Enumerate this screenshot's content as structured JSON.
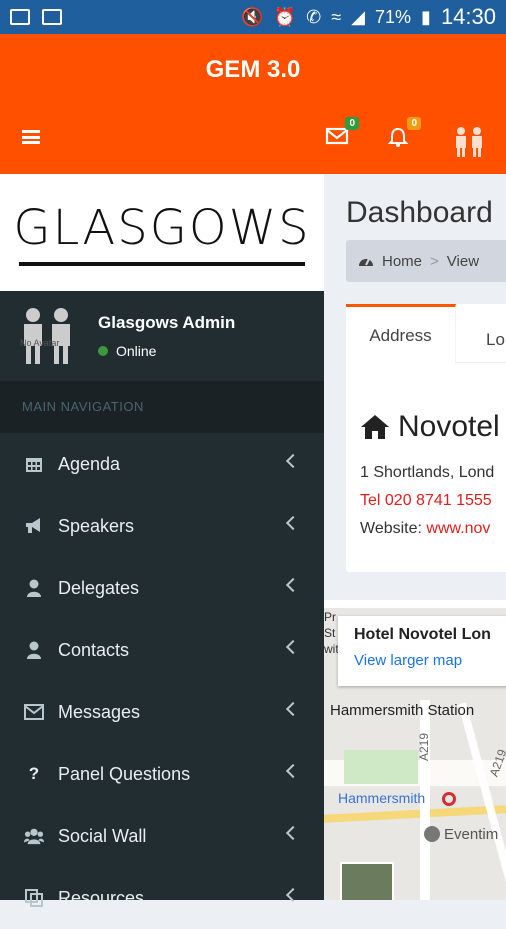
{
  "status_bar": {
    "battery": "71%",
    "time": "14:30"
  },
  "app": {
    "title": "GEM 3.0"
  },
  "header": {
    "mail_badge": "0",
    "bell_badge": "0",
    "colors": {
      "appbar": "#ff5000",
      "mail_badge": "#2e9b3e",
      "bell_badge": "#f39c12"
    }
  },
  "logo": {
    "text": "GLASGOWS"
  },
  "user": {
    "name": "Glasgows Admin",
    "status": "Online",
    "avatar_label": "No Avatar"
  },
  "nav": {
    "header": "MAIN NAVIGATION",
    "items": [
      {
        "label": "Agenda",
        "icon": "calendar-icon"
      },
      {
        "label": "Speakers",
        "icon": "megaphone-icon"
      },
      {
        "label": "Delegates",
        "icon": "user-icon"
      },
      {
        "label": "Contacts",
        "icon": "user-icon"
      },
      {
        "label": "Messages",
        "icon": "envelope-icon"
      },
      {
        "label": "Panel Questions",
        "icon": "question-icon"
      },
      {
        "label": "Social Wall",
        "icon": "users-icon"
      },
      {
        "label": "Resources",
        "icon": "copy-icon"
      }
    ]
  },
  "content": {
    "title": "Dashboard",
    "breadcrumb": {
      "home": "Home",
      "sep": ">",
      "view": "View"
    },
    "tabs": {
      "active": "Address",
      "second": "Lo"
    },
    "hotel": "Novotel",
    "address": "1 Shortlands, Lond",
    "tel_label": "Tel",
    "tel": "020 8741 1555",
    "website_label": "Website:",
    "website": "www.nov"
  },
  "map": {
    "card_title": "Hotel Novotel Lon",
    "card_link": "View larger map",
    "labels": {
      "hammersmith_station": "Hammersmith Station",
      "hammersmith": "Hammersmith",
      "eventim": "Eventim",
      "a219_1": "A219",
      "a219_2": "A219",
      "edge1": "Pr",
      "edge2": "St",
      "edge3": "wit"
    }
  }
}
